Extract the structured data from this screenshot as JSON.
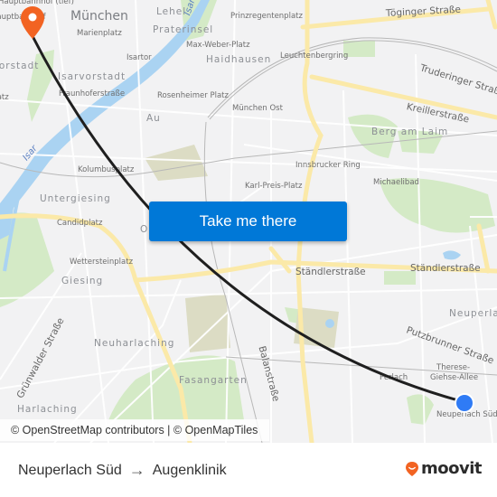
{
  "map": {
    "labels": {
      "muenchen": "München",
      "hauptbahnhof_tief": "Hauptbahnhof (tief)",
      "hauptbahnhof": "Hauptbahnhof",
      "marienplatz": "Marienplatz",
      "lehel": "Lehel",
      "praterinsel": "Praterinsel",
      "isartor": "Isartor",
      "max_weber_platz": "Max-Weber-Platz",
      "haidhausen": "Haidhausen",
      "prinzregentenplatz": "Prinzregentenplatz",
      "toeginger_strasse": "Töginger Straße",
      "leuchtenbergring": "Leuchtenbergring",
      "truderinger_strasse": "Truderinger Straße",
      "kreillerstrasse": "Kreillerstraße",
      "vorstadt": "Ludwigsvorstadt",
      "isarvorstadt": "Isarvorstadt",
      "fraunhoferstrasse": "Fraunhoferstraße",
      "rosenheimer_platz": "Rosenheimer Platz",
      "muenchen_ost": "München Ost",
      "goetheplatz": "Goetheplatz",
      "au": "Au",
      "berg_am_laim": "Berg am Laim",
      "isar": "Isar",
      "isar_north": "Isar",
      "kolumbusplatz": "Kolumbusplatz",
      "innsbrucker_ring": "Innsbrucker Ring",
      "karl_preis_platz": "Karl-Preis-Platz",
      "michaelibad": "Michaelibad",
      "untergiesing": "Untergiesing",
      "candidplatz": "Candidplatz",
      "obergiesing": "Ob",
      "wettersteinplatz": "Wettersteinplatz",
      "giesing": "Giesing",
      "staendlerstrasse_1": "Ständlerstraße",
      "staendlerstrasse_2": "Ständlerstraße",
      "neuperlach": "Neuperlach",
      "putzbrunner_strasse": "Putzbrunner Straße",
      "gruenwalder_strasse": "Grünwalder Straße",
      "neuharlaching": "Neuharlaching",
      "balanstrasse": "Balanstraße",
      "fasangarten": "Fasangarten",
      "harlaching": "Harlaching",
      "therese_giehse_allee_1": "Therese-",
      "therese_giehse_allee_2": "Giehse-Allee",
      "perlach": "Perlach",
      "neuperlach_sued": "Neuperlach Süd"
    },
    "origin_marker": "destination-pin",
    "destination_marker": "current-location-dot",
    "colors": {
      "route_line": "#1f1f1f",
      "pin": "#f26322",
      "dot": "#2f7bf5",
      "water": "#aad3f2",
      "park": "#cfe8c0",
      "major_road": "#fbe9a8"
    }
  },
  "cta": {
    "label": "Take me there",
    "color": "#0078d7"
  },
  "attribution": {
    "text": "© OpenStreetMap contributors | © OpenMapTiles"
  },
  "footer": {
    "origin": "Neuperlach Süd",
    "arrow": "→",
    "destination": "Augenklinik",
    "brand": "moovit",
    "brand_color": "#f26322"
  }
}
